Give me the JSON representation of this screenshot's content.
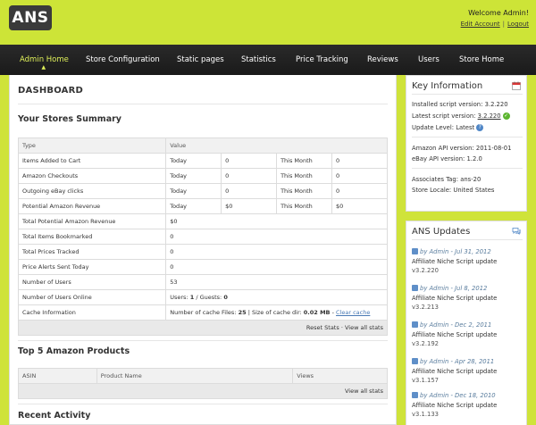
{
  "header": {
    "logo": "ANS",
    "welcome": "Welcome Admin!",
    "edit_account": "Edit Account",
    "separator": "|",
    "logout": "Logout"
  },
  "nav": {
    "items": [
      {
        "label": "Admin Home",
        "active": true
      },
      {
        "label": "Store Configuration"
      },
      {
        "label": "Static pages"
      },
      {
        "label": "Statistics"
      },
      {
        "label": "Price Tracking"
      },
      {
        "label": "Reviews"
      },
      {
        "label": "Users"
      },
      {
        "label": "Store Home"
      }
    ]
  },
  "dashboard": {
    "title": "DASHBOARD",
    "summary_title": "Your Stores Summary",
    "summary_headers": [
      "Type",
      "Value"
    ],
    "rows_period": [
      {
        "type": "Items Added to Cart",
        "today_label": "Today",
        "today": "0",
        "month_label": "This Month",
        "month": "0"
      },
      {
        "type": "Amazon Checkouts",
        "today_label": "Today",
        "today": "0",
        "month_label": "This Month",
        "month": "0"
      },
      {
        "type": "Outgoing eBay clicks",
        "today_label": "Today",
        "today": "0",
        "month_label": "This Month",
        "month": "0"
      },
      {
        "type": "Potential Amazon Revenue",
        "today_label": "Today",
        "today": "$0",
        "month_label": "This Month",
        "month": "$0"
      }
    ],
    "rows_single": [
      {
        "type": "Total Potential Amazon Revenue",
        "value": "$0"
      },
      {
        "type": "Total Items Bookmarked",
        "value": "0"
      },
      {
        "type": "Total Prices Tracked",
        "value": "0"
      },
      {
        "type": "Price Alerts Sent Today",
        "value": "0"
      },
      {
        "type": "Number of Users",
        "value": "53"
      }
    ],
    "users_online": {
      "type": "Number of Users Online",
      "users_label": "Users:",
      "users": "1",
      "guests_label": "/ Guests:",
      "guests": "0"
    },
    "cache": {
      "type": "Cache Information",
      "files_label": "Number of cache Files:",
      "files": "25",
      "size_label": "| Size of cache dir:",
      "size": "0.02 MB",
      "dash": "-",
      "clear": "Clear cache"
    },
    "summary_footer": {
      "reset": "Reset Stats",
      "dot": "·",
      "view_all": "View all stats"
    },
    "top5_title": "Top 5 Amazon Products",
    "top5_headers": [
      "ASIN",
      "Product Name",
      "Views"
    ],
    "top5_footer": "View all stats",
    "recent_title": "Recent Activity"
  },
  "key_info": {
    "title": "Key Information",
    "installed_label": "Installed script version:",
    "installed": "3.2.220",
    "latest_label": "Latest script version:",
    "latest": "3.2.220",
    "update_label": "Update Level:",
    "update": "Latest",
    "amazon_api_label": "Amazon API version:",
    "amazon_api": "2011-08-01",
    "ebay_api_label": "eBay API version:",
    "ebay_api": "1.2.0",
    "assoc_label": "Associates Tag:",
    "assoc": "ans-20",
    "locale_label": "Store Locale:",
    "locale": "United States"
  },
  "updates": {
    "title": "ANS Updates",
    "items": [
      {
        "meta": "by Admin - Jul 31, 2012",
        "title": "Affiliate Niche Script update",
        "version": "v3.2.220"
      },
      {
        "meta": "by Admin - Jul 8, 2012",
        "title": "Affiliate Niche Script update",
        "version": "v3.2.213"
      },
      {
        "meta": "by Admin - Dec 2, 2011",
        "title": "Affiliate Niche Script update",
        "version": "v3.2.192"
      },
      {
        "meta": "by Admin - Apr 28, 2011",
        "title": "Affiliate Niche Script update",
        "version": "v3.1.157"
      },
      {
        "meta": "by Admin - Dec 18, 2010",
        "title": "Affiliate Niche Script update",
        "version": "v3.1.133"
      }
    ]
  },
  "colors": {
    "accent": "#cde437",
    "nav_bg": "#222222",
    "link": "#4a7ab5"
  }
}
